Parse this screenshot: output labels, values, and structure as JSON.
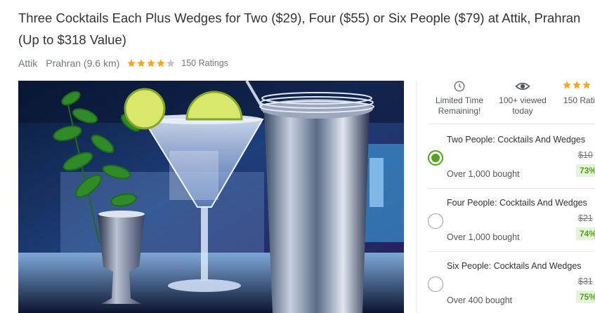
{
  "deal": {
    "title": "Three Cocktails Each Plus Wedges for Two ($29), Four ($55) or Six People ($79) at Attik, Prahran (Up to $318 Value)",
    "merchant": "Attik",
    "location": "Prahran (9.6 km)",
    "rating_stars": 4,
    "ratings_text": "150 Ratings"
  },
  "colors": {
    "star": "#f5a623",
    "star_empty": "#c2c4c6",
    "accent_green": "#53a318",
    "discount_bg": "#e4f3d9"
  },
  "features": [
    {
      "icon": "clock-icon",
      "line1": "Limited Time",
      "line2": "Remaining!"
    },
    {
      "icon": "eye-icon",
      "line1": "100+ viewed",
      "line2": "today"
    },
    {
      "icon": "star-icon",
      "line1": "",
      "line2": "150 Rati"
    }
  ],
  "options": [
    {
      "title": "Two People: Cocktails And Wedges",
      "bought": "Over 1,000 bought",
      "original_price": "$10",
      "discount": "73%",
      "selected": true
    },
    {
      "title": "Four People: Cocktails And Wedges",
      "bought": "Over 1,000 bought",
      "original_price": "$21",
      "discount": "74%",
      "selected": false
    },
    {
      "title": "Six People: Cocktails And Wedges",
      "bought": "Over 400 bought",
      "original_price": "$31",
      "discount": "75%",
      "selected": false
    }
  ]
}
